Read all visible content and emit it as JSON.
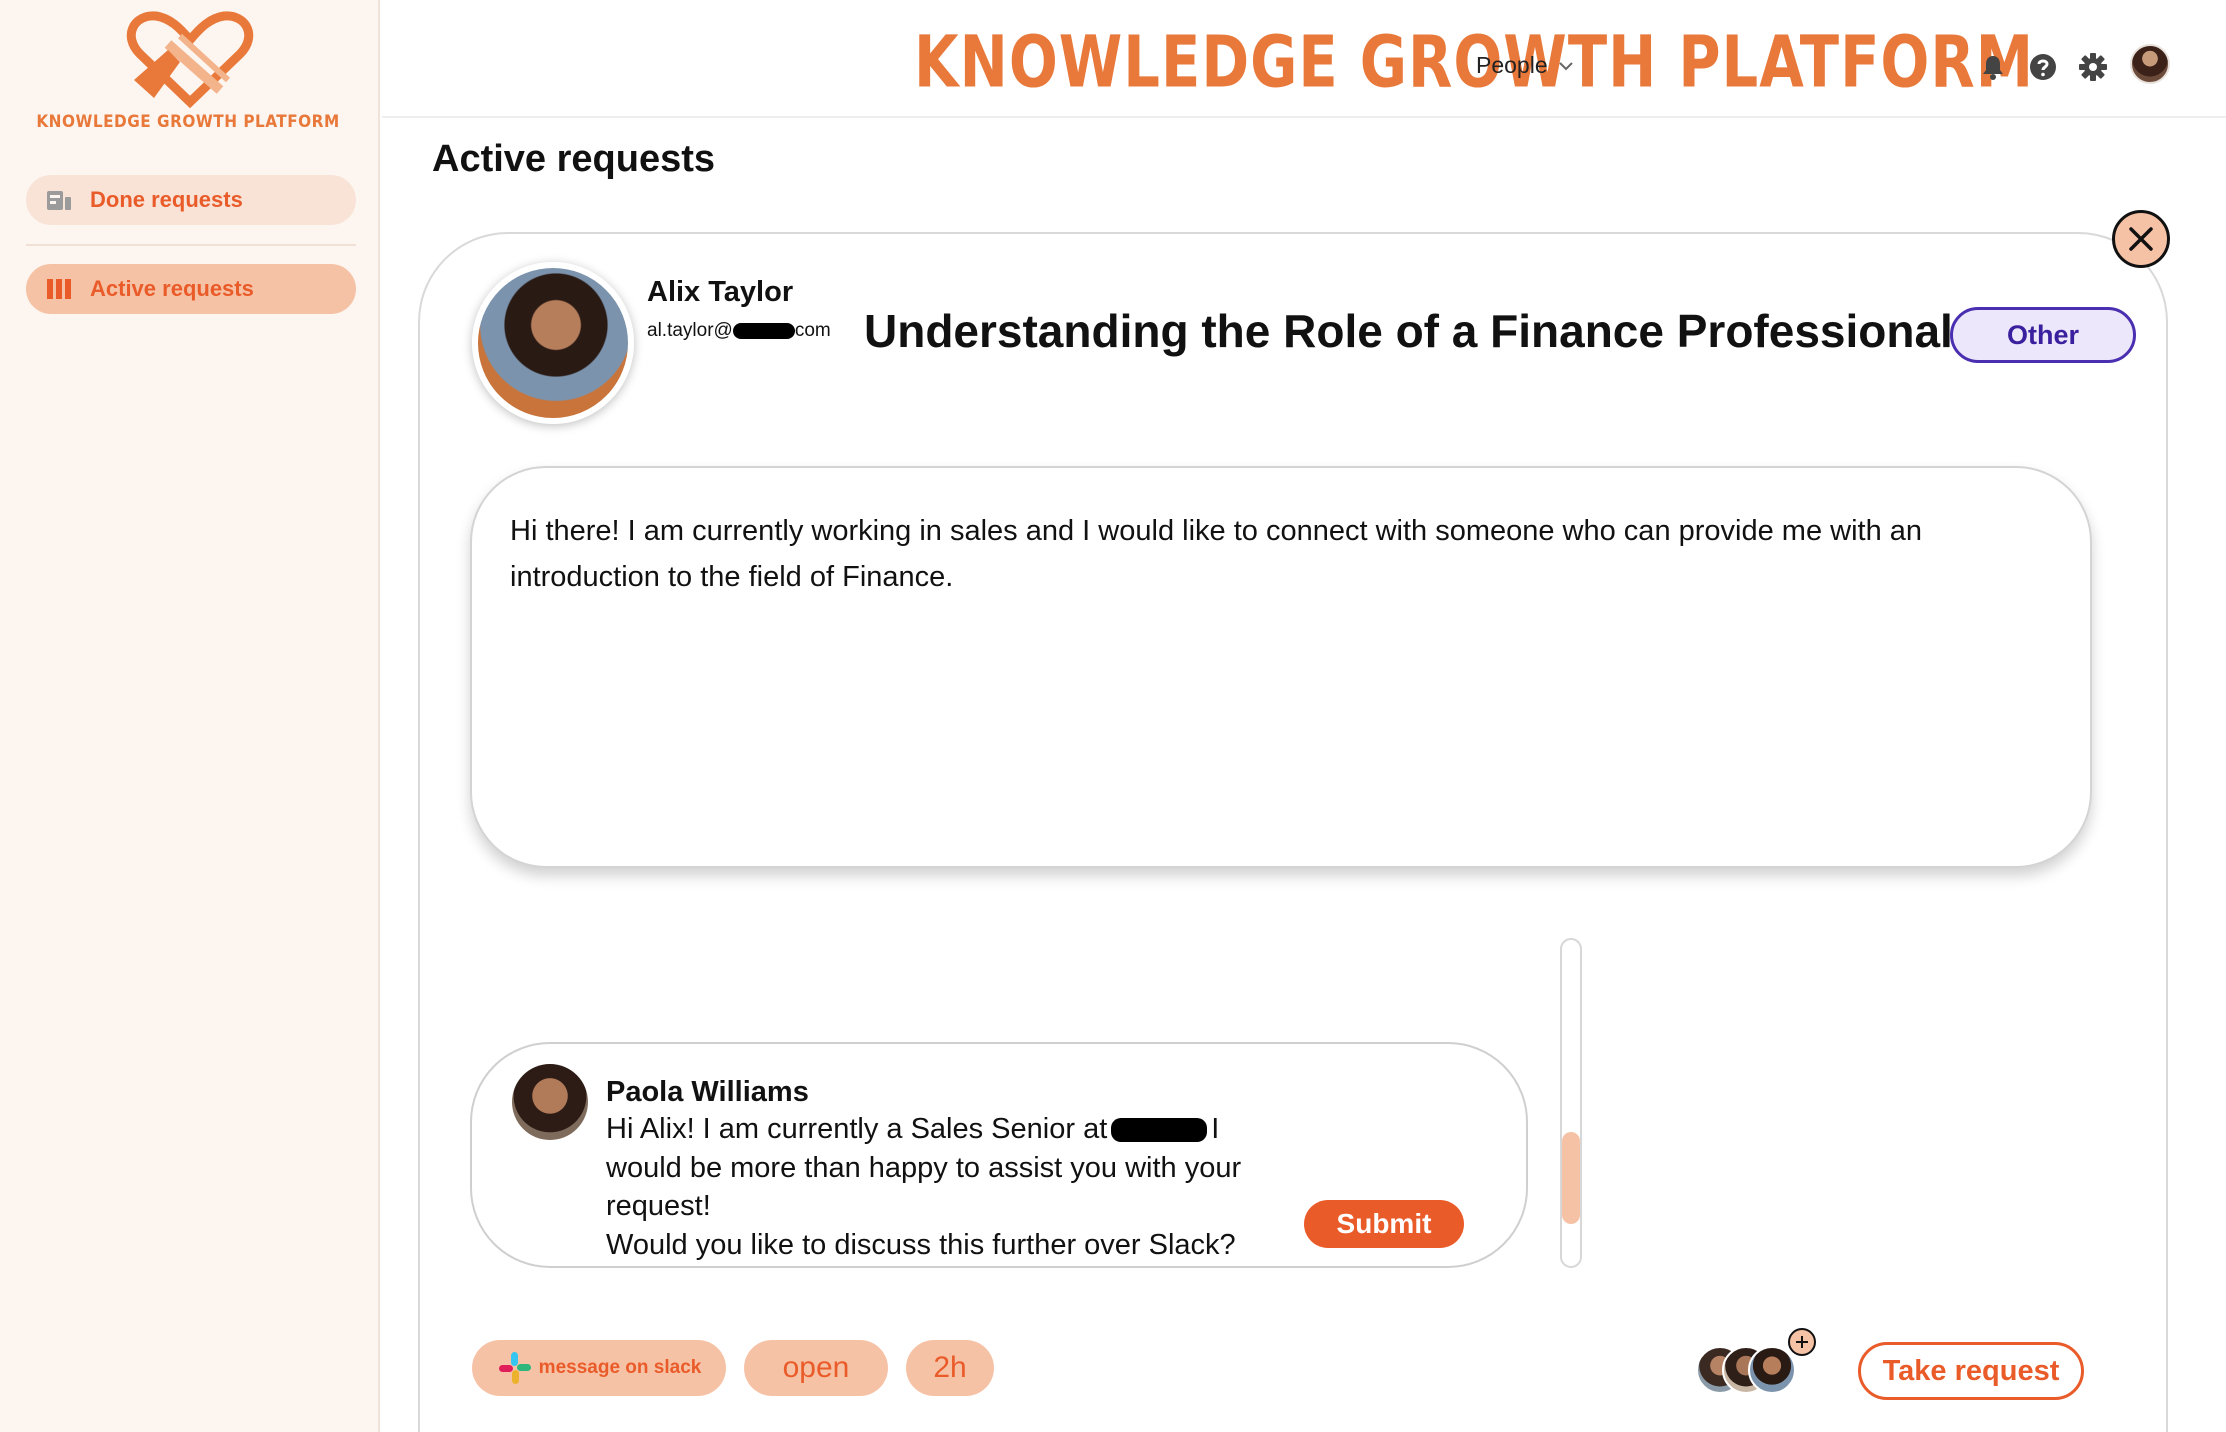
{
  "app": {
    "title": "KNOWLEDGE GROWTH PLATFORM",
    "logo_text": "KNOWLEDGE GROWTH PLATFORM",
    "accent_color": "#e8793a",
    "primary_color": "#ea5b2a"
  },
  "header": {
    "people_menu": "People",
    "icons": [
      "bell-icon",
      "help-icon",
      "gear-icon"
    ]
  },
  "sidebar": {
    "items": [
      {
        "label": "Done requests",
        "icon": "document-icon",
        "active": false
      },
      {
        "label": "Active requests",
        "icon": "columns-icon",
        "active": true
      }
    ]
  },
  "page": {
    "title": "Active requests"
  },
  "request": {
    "requester_name": "Alix Taylor",
    "email_prefix": "al.taylor@",
    "email_suffix": "com",
    "title": "Understanding the Role of a Finance Professional",
    "category": "Other",
    "message_line1": "Hi there! I am currently working in sales and I would like to connect with someone who can provide me with an",
    "message_line2": "introduction to the field of Finance."
  },
  "reply": {
    "author": "Paola Williams",
    "line1_prefix": "Hi Alix! I am currently a Sales Senior at",
    "line1_suffix": "I",
    "line2": "would be more than happy to assist you with your",
    "line3": "request!",
    "line4": "Would you like to discuss this further over Slack?",
    "submit_label": "Submit"
  },
  "footer": {
    "slack_label": "message on slack",
    "status": "open",
    "age": "2h",
    "take_label": "Take request"
  }
}
